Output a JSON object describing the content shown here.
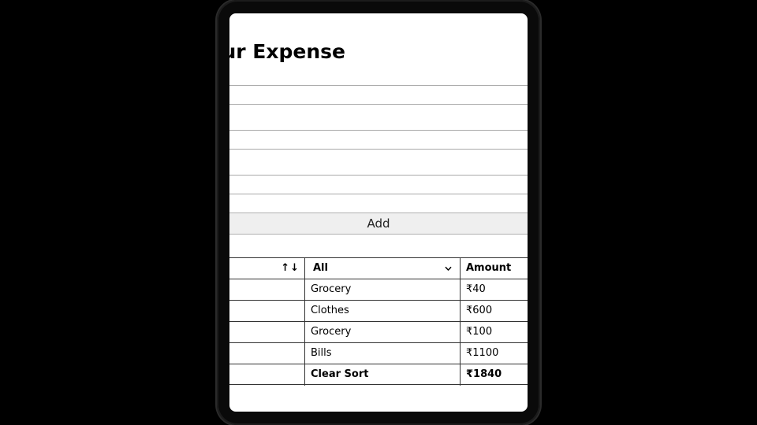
{
  "page": {
    "heading": "Add Your Expense"
  },
  "form": {
    "add_label": "Add"
  },
  "table": {
    "sort_up_icon": "↑",
    "sort_down_icon": "↓",
    "category_filter": {
      "selected": "All"
    },
    "amount_header": "Amount",
    "rows": [
      {
        "category": "Grocery",
        "amount": "₹40"
      },
      {
        "category": "Clothes",
        "amount": "₹600"
      },
      {
        "category": "Grocery",
        "amount": "₹100"
      },
      {
        "category": "Bills",
        "amount": "₹1100"
      }
    ],
    "footer": {
      "clear_sort_label": "Clear Sort",
      "total": "₹1840"
    }
  },
  "icons": {
    "filter_chevron": "chevron-down-icon"
  }
}
